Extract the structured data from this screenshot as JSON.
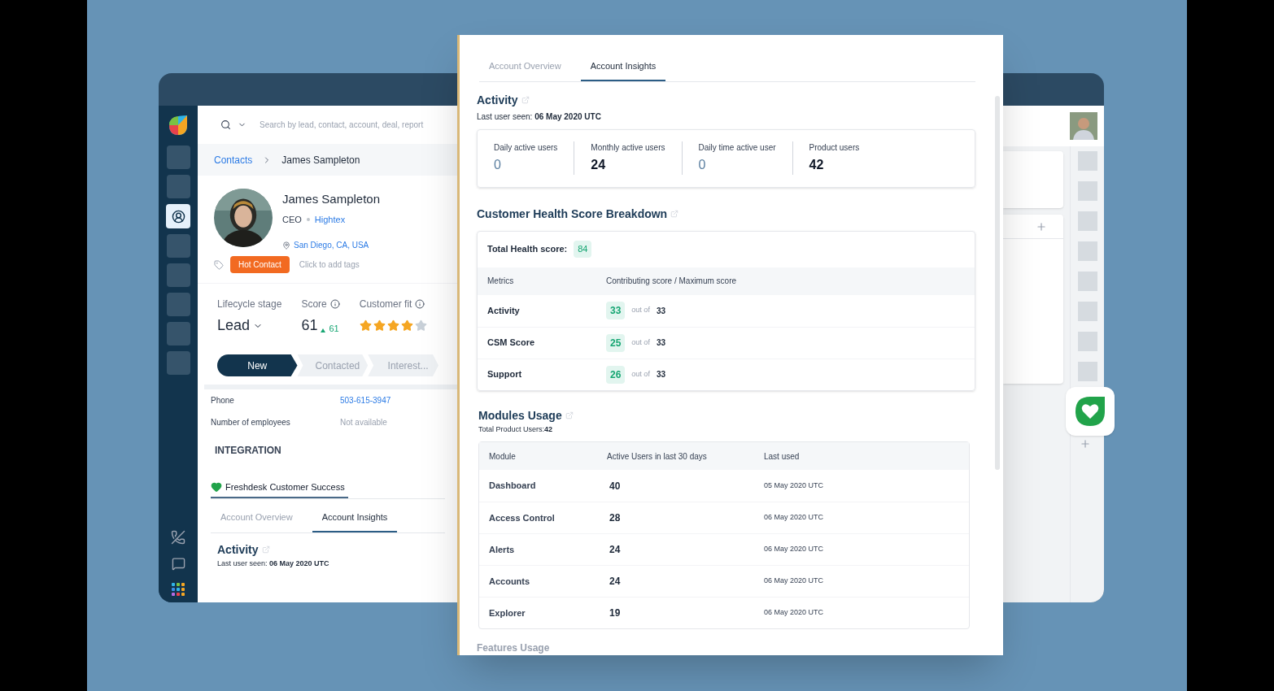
{
  "sidebar": {
    "items": [
      {
        "kind": "block",
        "selected": false
      },
      {
        "kind": "block",
        "selected": false
      },
      {
        "kind": "contacts",
        "selected": true
      },
      {
        "kind": "block",
        "selected": false
      },
      {
        "kind": "block",
        "selected": false
      },
      {
        "kind": "block",
        "selected": false
      },
      {
        "kind": "block",
        "selected": false
      },
      {
        "kind": "block",
        "selected": false
      }
    ]
  },
  "search": {
    "placeholder": "Search by lead, contact, account, deal, report"
  },
  "breadcrumb": [
    {
      "label": "Contacts",
      "kind": "link"
    },
    {
      "label": "James Sampleton",
      "kind": "current"
    }
  ],
  "contact": {
    "name": "James Sampleton",
    "title": "CEO",
    "company": "Hightex",
    "location": "San Diego, CA, USA",
    "tags": [
      {
        "label": "Hot Contact",
        "color": "#f26a21"
      }
    ],
    "tag_hint": "Click to add tags"
  },
  "stats": {
    "lifecycle_label": "Lifecycle stage",
    "lifecycle_value": "Lead",
    "score_label": "Score",
    "score": "61",
    "score_change": "61",
    "fit_label": "Customer fit",
    "stars": 4
  },
  "pipeline": [
    {
      "label": "New",
      "selected": true
    },
    {
      "label": "Contacted",
      "selected": false
    },
    {
      "label": "Interest...",
      "selected": false
    }
  ],
  "fields": [
    {
      "label": "Phone",
      "value": "503-615-3947",
      "kind": "link"
    },
    {
      "label": "Number of employees",
      "value": "Not available",
      "kind": "empty"
    }
  ],
  "integration": {
    "heading": "INTEGRATION",
    "app": "Freshdesk Customer Success",
    "tabs": [
      {
        "label": "Account Overview",
        "selected": false
      },
      {
        "label": "Account Insights",
        "selected": true
      }
    ],
    "activity_title": "Activity",
    "last_seen_label": "Last user seen:",
    "last_seen": "06 May 2020 UTC"
  },
  "panel": {
    "tabs": [
      {
        "label": "Account Overview",
        "selected": false
      },
      {
        "label": "Account Insights",
        "selected": true
      }
    ],
    "activity": {
      "title": "Activity",
      "last_seen_label": "Last user seen:",
      "last_seen": "06 May 2020 UTC",
      "metrics": [
        {
          "label": "Daily active users",
          "value": "0",
          "kind": "empty"
        },
        {
          "label": "Monthly active users",
          "value": "24",
          "kind": "count"
        },
        {
          "label": "Daily time active user",
          "value": "0",
          "kind": "empty"
        },
        {
          "label": "Product users",
          "value": "42",
          "kind": "count"
        }
      ]
    },
    "health": {
      "title": "Customer Health Score Breakdown",
      "total_label": "Total Health score:",
      "total": "84",
      "columns": [
        "Metrics",
        "Contributing score / Maximum score"
      ],
      "rows": [
        {
          "metric": "Activity",
          "score": "33",
          "joiner": "out of",
          "max": "33"
        },
        {
          "metric": "CSM Score",
          "score": "25",
          "joiner": "out of",
          "max": "33"
        },
        {
          "metric": "Support",
          "score": "26",
          "joiner": "out of",
          "max": "33"
        }
      ]
    },
    "modules": {
      "title": "Modules Usage",
      "total_label": "Total Product Users:",
      "total": "42",
      "columns": [
        "Module",
        "Active Users in last 30 days",
        "Last used"
      ],
      "rows": [
        {
          "module": "Dashboard",
          "users": "40",
          "last_used": "05 May 2020 UTC"
        },
        {
          "module": "Access Control",
          "users": "28",
          "last_used": "06 May 2020 UTC"
        },
        {
          "module": "Alerts",
          "users": "24",
          "last_used": "06 May 2020 UTC"
        },
        {
          "module": "Accounts",
          "users": "24",
          "last_used": "06 May 2020 UTC"
        },
        {
          "module": "Explorer",
          "users": "19",
          "last_used": "06 May 2020 UTC"
        }
      ]
    },
    "next_section": {
      "title": "Features Usage"
    }
  }
}
